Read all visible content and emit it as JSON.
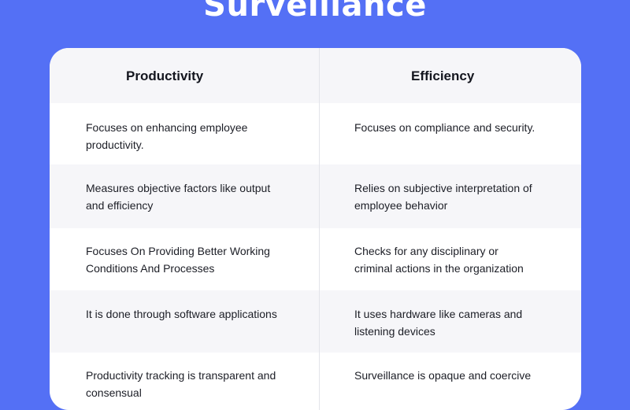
{
  "title": "Surveillance",
  "columns": [
    "Productivity",
    "Efficiency"
  ],
  "rows": [
    {
      "productivity": "Focuses on enhancing employee productivity.",
      "efficiency": "Focuses on compliance and security."
    },
    {
      "productivity": "Measures objective factors like output and efficiency",
      "efficiency": "Relies on subjective interpretation of employee behavior"
    },
    {
      "productivity": "Focuses On Providing Better Working Conditions And Processes",
      "efficiency": "Checks for any disciplinary or criminal actions in the organization"
    },
    {
      "productivity": "It is done through software applications",
      "efficiency": "It uses hardware like cameras and listening devices"
    },
    {
      "productivity": "Productivity tracking is transparent and consensual",
      "efficiency": "Surveillance is opaque and coercive"
    }
  ]
}
